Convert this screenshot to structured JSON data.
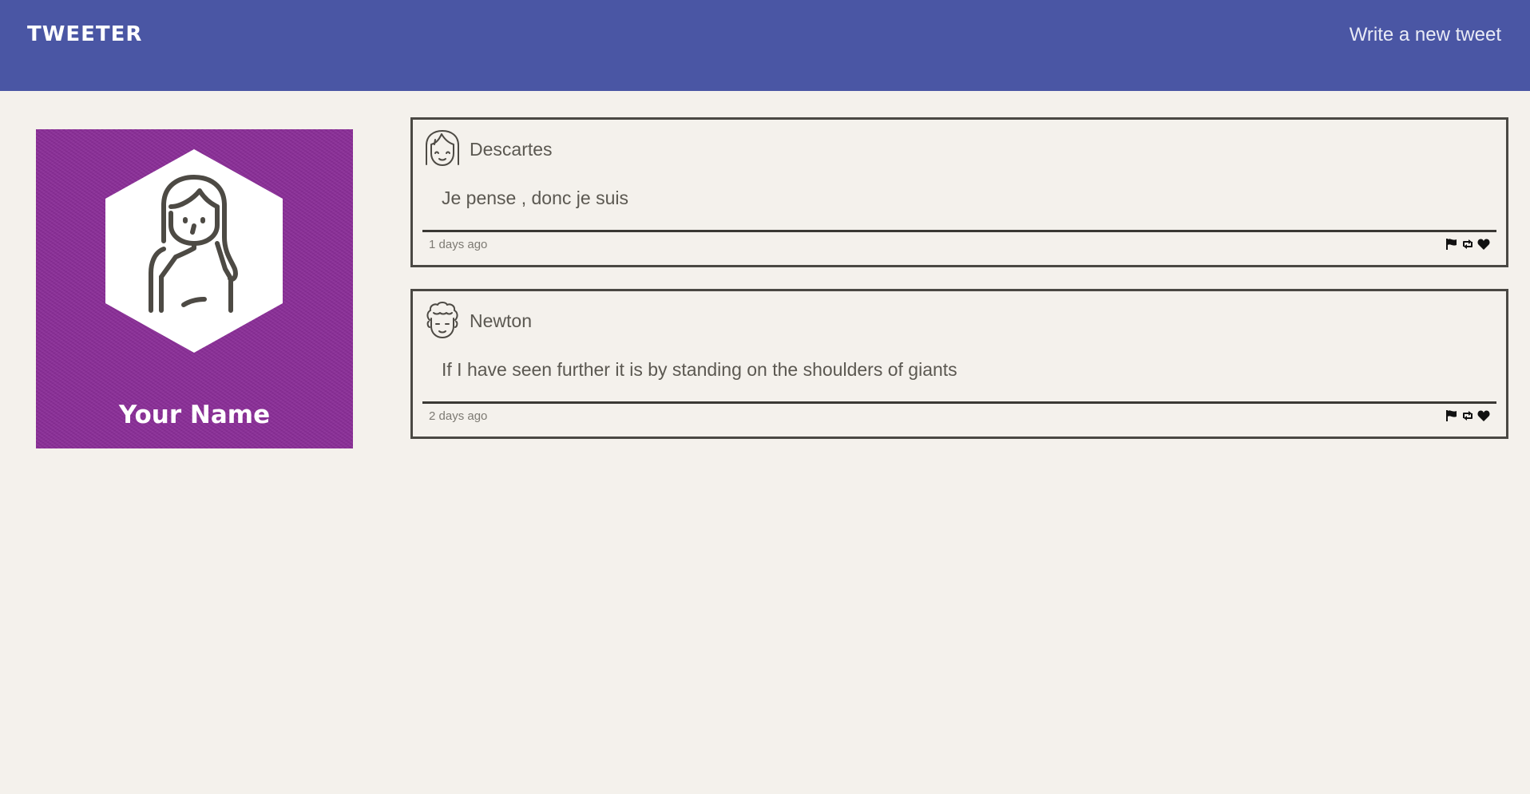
{
  "header": {
    "brand": "TWEETER",
    "compose_label": "Write a new tweet",
    "background_color": "#4a56a4"
  },
  "profile": {
    "name": "Your Name",
    "avatar_icon": "woman-avatar-icon",
    "background_color": "#8a2d97"
  },
  "tweets": [
    {
      "author": "Descartes",
      "avatar_icon": "girl-avatar-icon",
      "text": "Je pense , donc je suis",
      "time": "1 days ago",
      "actions": [
        "flag-icon",
        "retweet-icon",
        "heart-icon"
      ]
    },
    {
      "author": "Newton",
      "avatar_icon": "man-avatar-icon",
      "text": "If I have seen further it is by standing on the shoulders of giants",
      "time": "2 days ago",
      "actions": [
        "flag-icon",
        "retweet-icon",
        "heart-icon"
      ]
    }
  ]
}
